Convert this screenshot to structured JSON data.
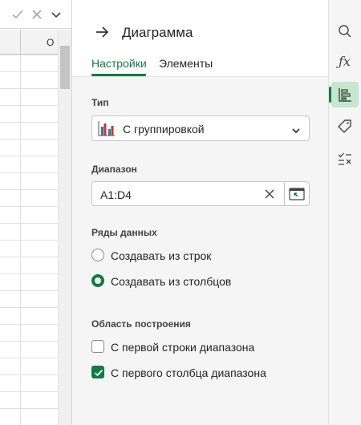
{
  "sheet": {
    "column_letter": "O",
    "formula_bar": {
      "icons": [
        "check-icon",
        "close-icon",
        "chevron-down-icon"
      ]
    }
  },
  "pane": {
    "title": "Диаграмма",
    "tabs": [
      {
        "label": "Настройки",
        "active": true
      },
      {
        "label": "Элементы",
        "active": false
      }
    ],
    "type": {
      "label": "Тип",
      "value": "С группировкой",
      "icon": "clustered-column-chart-icon"
    },
    "range": {
      "label": "Диапазон",
      "value": "A1:D4"
    },
    "series": {
      "label": "Ряды данных",
      "options": [
        {
          "label": "Создавать из строк",
          "selected": false
        },
        {
          "label": "Создавать из столбцов",
          "selected": true
        }
      ]
    },
    "plot_area": {
      "label": "Область построения",
      "options": [
        {
          "label": "С первой строки диапазона",
          "checked": false
        },
        {
          "label": "С первого столбца диапазона",
          "checked": true
        }
      ]
    }
  },
  "rail": {
    "buttons": [
      {
        "icon": "search-icon",
        "active": false
      },
      {
        "icon": "function-icon",
        "active": false
      },
      {
        "icon": "chart-settings-icon",
        "active": true
      },
      {
        "icon": "tag-icon",
        "active": false
      },
      {
        "icon": "checklist-icon",
        "active": false
      }
    ]
  },
  "colors": {
    "accent": "#107c41",
    "active_rail_bg": "#c7e6cf",
    "pane_bg": "#f5f5f5"
  }
}
